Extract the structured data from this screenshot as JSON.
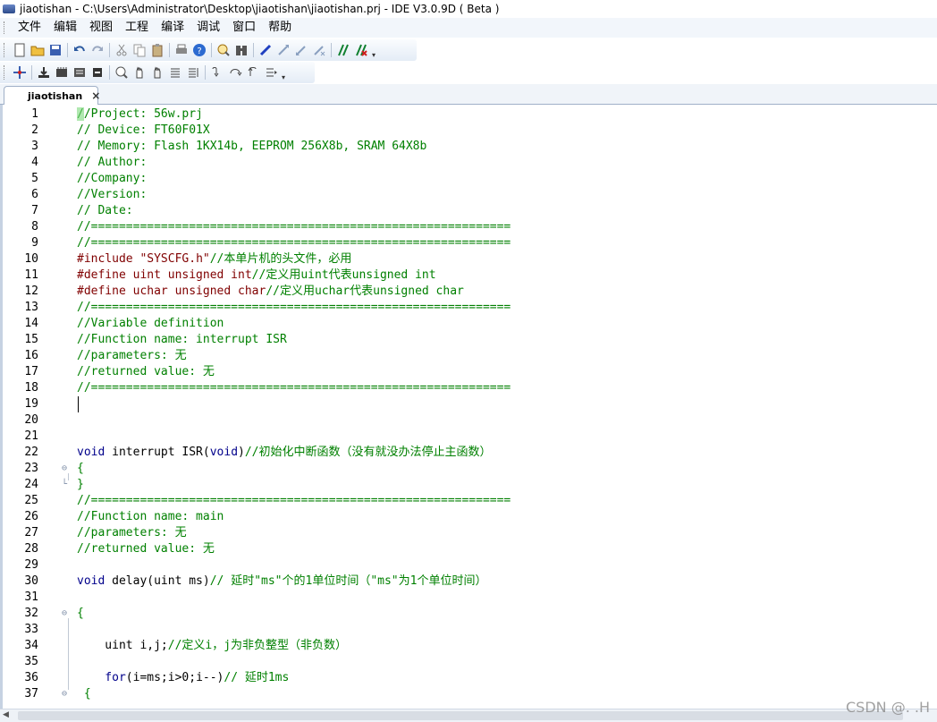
{
  "window": {
    "title": "jiaotishan - C:\\Users\\Administrator\\Desktop\\jiaotishan\\jiaotishan.prj - IDE V3.0.9D ( Beta )"
  },
  "menu": [
    "文件",
    "编辑",
    "视图",
    "工程",
    "编译",
    "调试",
    "窗口",
    "帮助"
  ],
  "toolbar1": [
    "new-file-icon",
    "open-folder-icon",
    "save-icon",
    "sep",
    "undo-icon",
    "redo-icon",
    "sep",
    "cut-icon",
    "copy-icon",
    "paste-icon",
    "sep",
    "print-icon",
    "help-icon",
    "sep",
    "find-icon",
    "binoculars-icon",
    "sep",
    "bookmark-toggle-icon",
    "bookmark-next-icon",
    "bookmark-prev-icon",
    "bookmark-clear-icon",
    "sep",
    "comment-icon",
    "uncomment-icon"
  ],
  "toolbar2": [
    "debug-move-icon",
    "sep",
    "download-icon",
    "memory-icon",
    "registers-icon",
    "reset-icon",
    "sep",
    "zoom-icon",
    "hand-icon",
    "hand2-icon",
    "list-icon",
    "list2-icon",
    "sep",
    "step-into-icon",
    "step-over-icon",
    "step-out-icon",
    "run-to-cursor-icon"
  ],
  "tab": {
    "label": "jiaotishan",
    "close": "×"
  },
  "editor": {
    "lines": [
      {
        "n": "1",
        "segments": [
          [
            "c-comment",
            "//Project: 56w.prj"
          ]
        ]
      },
      {
        "n": "2",
        "segments": [
          [
            "c-comment",
            "// Device: FT60F01X"
          ]
        ]
      },
      {
        "n": "3",
        "segments": [
          [
            "c-comment",
            "// Memory: Flash 1KX14b, EEPROM 256X8b, SRAM 64X8b"
          ]
        ]
      },
      {
        "n": "4",
        "segments": [
          [
            "c-comment",
            "// Author:"
          ]
        ]
      },
      {
        "n": "5",
        "segments": [
          [
            "c-comment",
            "//Company:"
          ]
        ]
      },
      {
        "n": "6",
        "segments": [
          [
            "c-comment",
            "//Version:"
          ]
        ]
      },
      {
        "n": "7",
        "segments": [
          [
            "c-comment",
            "// Date:"
          ]
        ]
      },
      {
        "n": "8",
        "segments": [
          [
            "c-comment",
            "//============================================================"
          ]
        ]
      },
      {
        "n": "9",
        "segments": [
          [
            "c-comment",
            "//============================================================"
          ]
        ]
      },
      {
        "n": "10",
        "segments": [
          [
            "c-pre",
            "#include "
          ],
          [
            "c-str",
            "\"SYSCFG.h\""
          ],
          [
            "c-comment",
            "//本单片机的头文件，必用"
          ]
        ]
      },
      {
        "n": "11",
        "segments": [
          [
            "c-pre",
            "#define uint unsigned int"
          ],
          [
            "c-comment",
            "//定义用uint代表unsigned int"
          ]
        ]
      },
      {
        "n": "12",
        "segments": [
          [
            "c-pre",
            "#define uchar unsigned char"
          ],
          [
            "c-comment",
            "//定义用uchar代表unsigned char"
          ]
        ]
      },
      {
        "n": "13",
        "segments": [
          [
            "c-comment",
            "//============================================================"
          ]
        ]
      },
      {
        "n": "14",
        "segments": [
          [
            "c-comment",
            "//Variable definition"
          ]
        ]
      },
      {
        "n": "15",
        "segments": [
          [
            "c-comment",
            "//Function name: interrupt ISR"
          ]
        ]
      },
      {
        "n": "16",
        "segments": [
          [
            "c-comment",
            "//parameters: 无"
          ]
        ]
      },
      {
        "n": "17",
        "segments": [
          [
            "c-comment",
            "//returned value: 无"
          ]
        ]
      },
      {
        "n": "18",
        "segments": [
          [
            "c-comment",
            "//============================================================"
          ]
        ]
      },
      {
        "n": "19",
        "segments": []
      },
      {
        "n": "20",
        "segments": []
      },
      {
        "n": "21",
        "segments": []
      },
      {
        "n": "22",
        "segments": [
          [
            "c-kw",
            "void"
          ],
          [
            "c-plain",
            " interrupt ISR("
          ],
          [
            "c-kw",
            "void"
          ],
          [
            "c-plain",
            ")"
          ],
          [
            "c-comment",
            "//初始化中断函数（没有就没办法停止主函数）"
          ]
        ]
      },
      {
        "n": "23",
        "fold": "⊖",
        "segments": [
          [
            "c-comment",
            "{"
          ]
        ]
      },
      {
        "n": "24",
        "fold": "└",
        "segments": [
          [
            "c-comment",
            "}"
          ]
        ]
      },
      {
        "n": "25",
        "segments": [
          [
            "c-comment",
            "//============================================================"
          ]
        ]
      },
      {
        "n": "26",
        "segments": [
          [
            "c-comment",
            "//Function name: main"
          ]
        ]
      },
      {
        "n": "27",
        "segments": [
          [
            "c-comment",
            "//parameters: 无"
          ]
        ]
      },
      {
        "n": "28",
        "segments": [
          [
            "c-comment",
            "//returned value: 无"
          ]
        ]
      },
      {
        "n": "29",
        "segments": []
      },
      {
        "n": "30",
        "segments": [
          [
            "c-kw",
            "void"
          ],
          [
            "c-plain",
            " delay(uint ms)"
          ],
          [
            "c-comment",
            "// 延时\"ms\"个的1单位时间（\"ms\"为1个单位时间）"
          ]
        ]
      },
      {
        "n": "31",
        "segments": []
      },
      {
        "n": "32",
        "fold": "⊖",
        "segments": [
          [
            "c-comment",
            "{"
          ]
        ]
      },
      {
        "n": "33",
        "segments": []
      },
      {
        "n": "34",
        "segments": [
          [
            "c-plain",
            "    uint i,j;"
          ],
          [
            "c-comment",
            "//定义i，j为非负整型（非负数）"
          ]
        ]
      },
      {
        "n": "35",
        "segments": []
      },
      {
        "n": "36",
        "segments": [
          [
            "c-kw",
            "    for"
          ],
          [
            "c-plain",
            "(i=ms;i>0;i--)"
          ],
          [
            "c-comment",
            "// 延时1ms"
          ]
        ]
      },
      {
        "n": "37",
        "fold": "⊖",
        "segments": [
          [
            "c-comment",
            " {"
          ]
        ]
      }
    ]
  },
  "watermark": "CSDN @. .H"
}
